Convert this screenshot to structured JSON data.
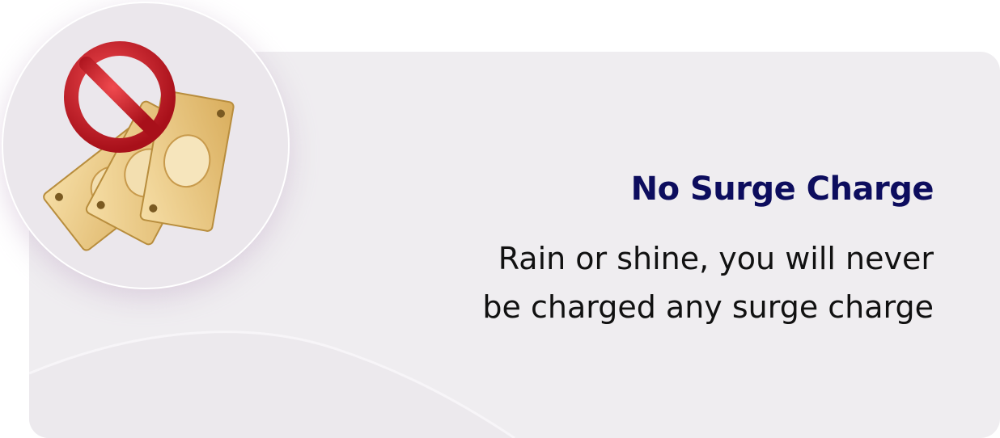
{
  "feature": {
    "title": "No Surge Charge",
    "description_lines": [
      "Rain or shine, you will never",
      "be charged any surge charge"
    ],
    "icon": "no-money-icon"
  },
  "colors": {
    "card_background": "#efedf0",
    "title": "#0d0d5e",
    "body_text": "#111111",
    "prohibition_red": "#d01c28",
    "banknote_gold": "#e8c682"
  }
}
